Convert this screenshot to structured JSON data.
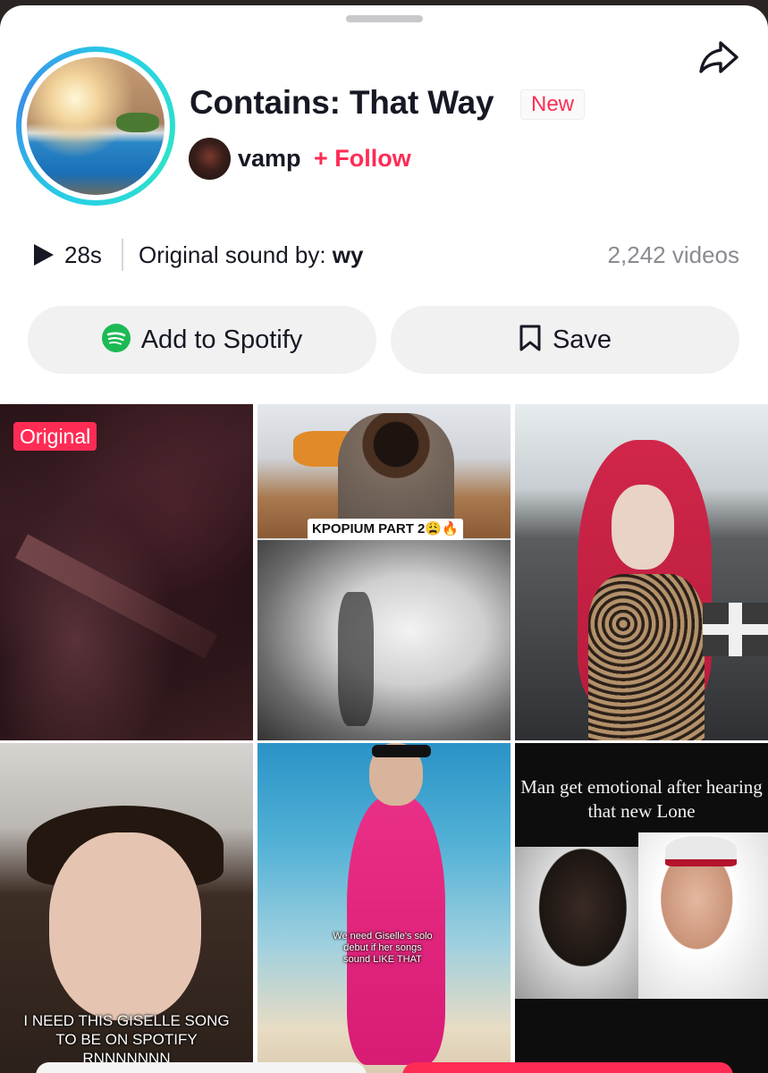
{
  "sound": {
    "title": "Contains: That Way",
    "badge": "New",
    "creator": "vamp",
    "follow_label": "+ Follow",
    "duration": "28s",
    "original_sound_prefix": "Original sound by:",
    "original_sound_author": "wy",
    "video_count": "2,242 videos"
  },
  "actions": {
    "spotify_label": "Add to Spotify",
    "save_label": "Save"
  },
  "grid": {
    "original_badge": "Original",
    "tile2_caption": "KPOPIUM PART 2😩🔥",
    "tile4_caption": "I NEED THIS GISELLE SONG TO BE ON SPOTIFY RNNNNNNN",
    "tile5_caption": "We need Giselle's solo debut if her songs sound LIKE THAT",
    "tile6_caption": "Man get emotional after hearing that new Lone"
  },
  "colors": {
    "accent": "#fe2c55",
    "spotify": "#1db954",
    "text": "#161823",
    "muted": "#8a8b91"
  },
  "icons": [
    "share-icon",
    "play-icon",
    "spotify-icon",
    "bookmark-icon"
  ]
}
